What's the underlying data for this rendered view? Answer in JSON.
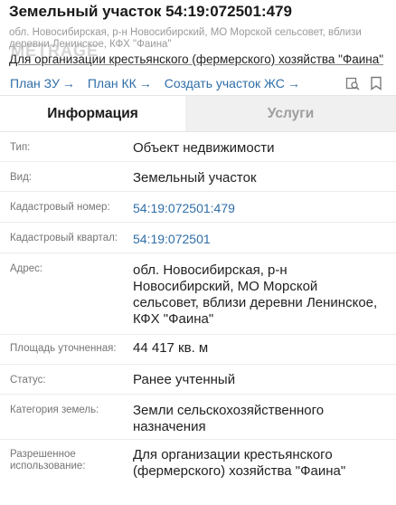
{
  "header": {
    "title": "Земельный участок 54:19:072501:479",
    "subtitle": "обл. Новосибирская, р-н Новосибирский, МО Морской сельсовет, вблизи деревни Ленинское, КФХ \"Фаина\"",
    "purpose": "Для организации крестьянского (фермерского) хозяйства \"Фаина\"",
    "watermark": "METRAGE"
  },
  "links": [
    {
      "label": "План ЗУ",
      "arrow": "→"
    },
    {
      "label": "План КК",
      "arrow": "→"
    },
    {
      "label": "Создать участок ЖС",
      "arrow": "→"
    }
  ],
  "tools": [
    "search-map-icon",
    "bookmark-icon"
  ],
  "tabs": [
    {
      "label": "Информация",
      "active": true
    },
    {
      "label": "Услуги",
      "active": false
    }
  ],
  "rows": [
    {
      "label": "Тип:",
      "value": "Объект недвижимости"
    },
    {
      "label": "Вид:",
      "value": "Земельный участок"
    },
    {
      "label": "Кадастровый номер:",
      "value": "54:19:072501:479"
    },
    {
      "label": "Кадастровый квартал:",
      "value": "54:19:072501"
    },
    {
      "label": "Адрес:",
      "value": "обл. Новосибирская, р-н Новосибирский, МО Морской сельсовет, вблизи деревни Ленинское, КФХ \"Фаина\""
    },
    {
      "label": "Площадь уточненная:",
      "value": "44 417 кв. м"
    },
    {
      "label": "Статус:",
      "value": "Ранее учтенный"
    },
    {
      "label": "Категория земель:",
      "value": "Земли сельскохозяйственного назначения"
    },
    {
      "label": "Разрешенное использование:",
      "value": "Для организации крестьянского (фермерского) хозяйства \"Фаина\""
    }
  ],
  "colors": {
    "link": "#2f6ea8",
    "label": "#757575",
    "tab_inactive_bg": "#f0f0f0"
  }
}
